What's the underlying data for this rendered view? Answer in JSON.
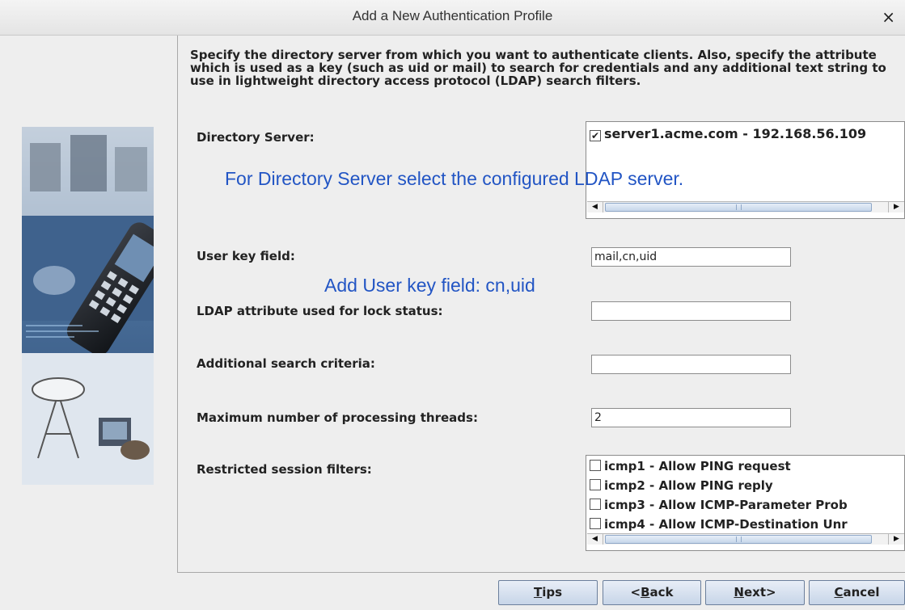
{
  "window": {
    "title": "Add a New Authentication Profile",
    "close_glyph": "×"
  },
  "intro_text": "Specify the directory server from which you want to authenticate clients. Also, specify the attribute which is used as a key (such as uid or mail) to search for credentials and any additional text string to use in lightweight directory access protocol (LDAP) search filters.",
  "directory_server": {
    "label": "Directory Server:",
    "items": [
      {
        "checked": true,
        "text": "server1.acme.com - 192.168.56.109"
      }
    ]
  },
  "annotations": {
    "directory": "For Directory Server select the configured LDAP server.",
    "user_key": "Add User key field: cn,uid"
  },
  "user_key_field": {
    "label": "User key field:",
    "value": "mail,cn,uid"
  },
  "lock_status": {
    "label": "LDAP attribute used for lock status:",
    "value": ""
  },
  "search_criteria": {
    "label": "Additional search criteria:",
    "value": ""
  },
  "max_threads": {
    "label": "Maximum number of processing threads:",
    "value": "2"
  },
  "session_filters": {
    "label": "Restricted session filters:",
    "items": [
      {
        "checked": false,
        "text": "icmp1 - Allow PING request"
      },
      {
        "checked": false,
        "text": "icmp2 - Allow PING reply"
      },
      {
        "checked": false,
        "text": "icmp3 - Allow ICMP-Parameter Prob"
      },
      {
        "checked": false,
        "text": "icmp4 - Allow ICMP-Destination Unr"
      }
    ]
  },
  "buttons": {
    "tips": {
      "mnemonic": "T",
      "rest": "ips"
    },
    "back": {
      "pre": "<",
      "mnemonic": "B",
      "rest": "ack"
    },
    "next": {
      "mnemonic": "N",
      "rest": "ext>"
    },
    "cancel": {
      "mnemonic": "C",
      "rest": "ancel"
    }
  },
  "colors": {
    "annotation": "#2255c4",
    "button_border": "#6b7f9c",
    "check_mark": "✔"
  },
  "icons": [
    "close-icon",
    "scroll-left-icon",
    "scroll-right-icon",
    "checkbox-icon",
    "wizard-side-image"
  ]
}
